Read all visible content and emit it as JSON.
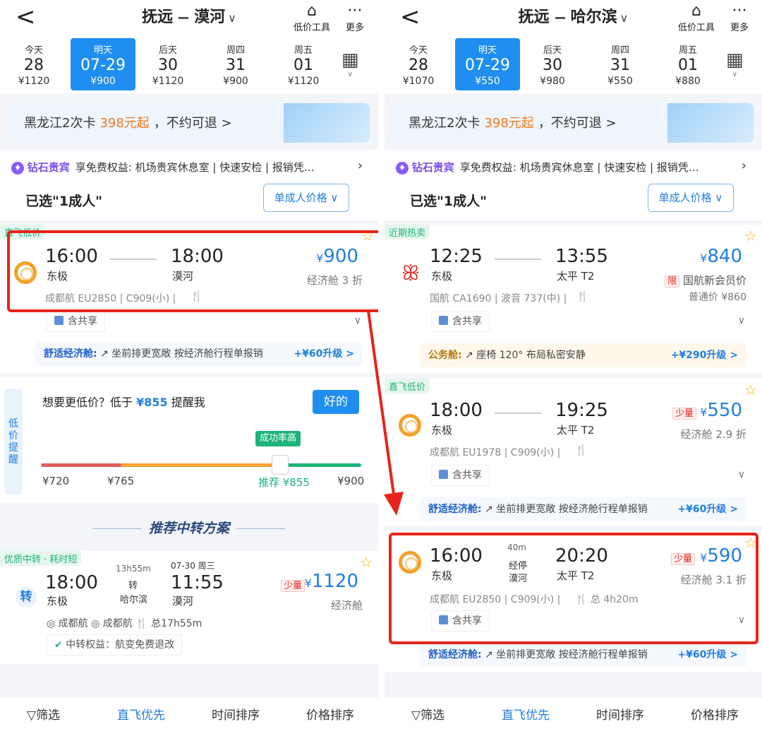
{
  "left": {
    "back": "<",
    "origin": "抚远",
    "dest": "漠河",
    "tools": [
      {
        "icon": "price-tool-icon",
        "label": "低价工具"
      },
      {
        "icon": "more-icon",
        "label": "更多"
      }
    ],
    "dates": [
      {
        "w": "今天",
        "d": "28",
        "p": "¥1120"
      },
      {
        "w": "明天",
        "d": "07-29",
        "p": "¥900"
      },
      {
        "w": "后天",
        "d": "30",
        "p": "¥1120"
      },
      {
        "w": "周四",
        "d": "31",
        "p": "¥900"
      },
      {
        "w": "周五",
        "d": "01",
        "p": "¥1120"
      }
    ],
    "banner": {
      "a": "黑龙江2次卡",
      "b": "398元起",
      "c": "，不约可退 >"
    },
    "vip": {
      "title": "钻石贵宾",
      "text": "享免费权益: 机场贵宾休息室 | 快速安检 | 报销凭…"
    },
    "selected": "已选\"1成人\"",
    "price_btn": "单成人价格",
    "flight": {
      "tag": "直飞低价",
      "dep": "16:00",
      "dep_ap": "东极",
      "arr": "18:00",
      "arr_ap": "漠河",
      "price": "900",
      "cabin": "经济舱 3 折",
      "airline": "成都航 EU2850 | C909(小) |",
      "share": "含共享",
      "upgrade_label": "舒适经济舱:",
      "upgrade_text": "坐前排更宽敞   按经济舱行程单报销",
      "upgrade_plus": "+¥60升级 >"
    },
    "alert": {
      "side": "低价提醒",
      "q1": "想要更低价？低于",
      "q2": "¥855",
      "q3": "提醒我",
      "ok": "好的",
      "hi": "成功率高",
      "l1": "¥720",
      "l2": "¥765",
      "l3": "推荐 ¥855",
      "l4": "¥900"
    },
    "rec_title": "推荐中转方案",
    "transfer": {
      "tag": "优质中转 · 耗时短",
      "icon": "转",
      "dep": "18:00",
      "dep_ap": "东极",
      "dur": "13h55m",
      "via1": "转",
      "via2": "哈尔滨",
      "arr_date": "07-30 周三",
      "arr": "11:55",
      "arr_ap": "漠河",
      "low": "少量",
      "price": "1120",
      "cabin": "经济舱",
      "air1": "成都航",
      "air2": "成都航",
      "total": "总17h55m",
      "benefit": "中转权益：航变免费退改"
    }
  },
  "right": {
    "back": "<",
    "origin": "抚远",
    "dest": "哈尔滨",
    "dates": [
      {
        "w": "今天",
        "d": "28",
        "p": "¥1070"
      },
      {
        "w": "明天",
        "d": "07-29",
        "p": "¥550"
      },
      {
        "w": "后天",
        "d": "30",
        "p": "¥980"
      },
      {
        "w": "周四",
        "d": "31",
        "p": "¥550"
      },
      {
        "w": "周五",
        "d": "01",
        "p": "¥880"
      }
    ],
    "f1": {
      "tag": "近期热卖",
      "dep": "12:25",
      "dep_ap": "东极",
      "arr": "13:55",
      "arr_ap": "太平 T2",
      "price": "840",
      "member": "国航新会员价",
      "member_tag": "限",
      "normal": "普通价 ¥860",
      "airline": "国航 CA1690 | 波音 737(中) |",
      "share": "含共享",
      "upg_label": "公务舱:",
      "upg_text": "座椅 120°   布局私密安静",
      "upg_plus": "+¥290升级 >"
    },
    "f2": {
      "tag": "直飞低价",
      "dep": "18:00",
      "dep_ap": "东极",
      "arr": "19:25",
      "arr_ap": "太平 T2",
      "low": "少量",
      "price": "550",
      "cabin": "经济舱 2.9 折",
      "airline": "成都航 EU1978 | C909(小) |",
      "share": "含共享",
      "upg_label": "舒适经济舱:",
      "upg_text": "坐前排更宽敞   按经济舱行程单报销",
      "upg_plus": "+¥60升级 >"
    },
    "f3": {
      "dep": "16:00",
      "dep_ap": "东极",
      "stop_time": "40m",
      "stop": "经停",
      "stop_ap": "漠河",
      "arr": "20:20",
      "arr_ap": "太平 T2",
      "low": "少量",
      "price": "590",
      "cabin": "经济舱 3.1 折",
      "airline": "成都航 EU2850 | C909(小) |",
      "total": "总 4h20m",
      "share": "含共享",
      "upg_label": "舒适经济舱:",
      "upg_text": "坐前排更宽敞   按经济舱行程单报销",
      "upg_plus": "+¥60升级 >"
    }
  },
  "bottom": [
    "筛选",
    "直飞优先",
    "时间排序",
    "价格排序"
  ],
  "colors": {
    "accent": "#1f8ef1",
    "highlight": "#e8231b",
    "green": "#1db47a",
    "orange": "#f07a1c"
  }
}
